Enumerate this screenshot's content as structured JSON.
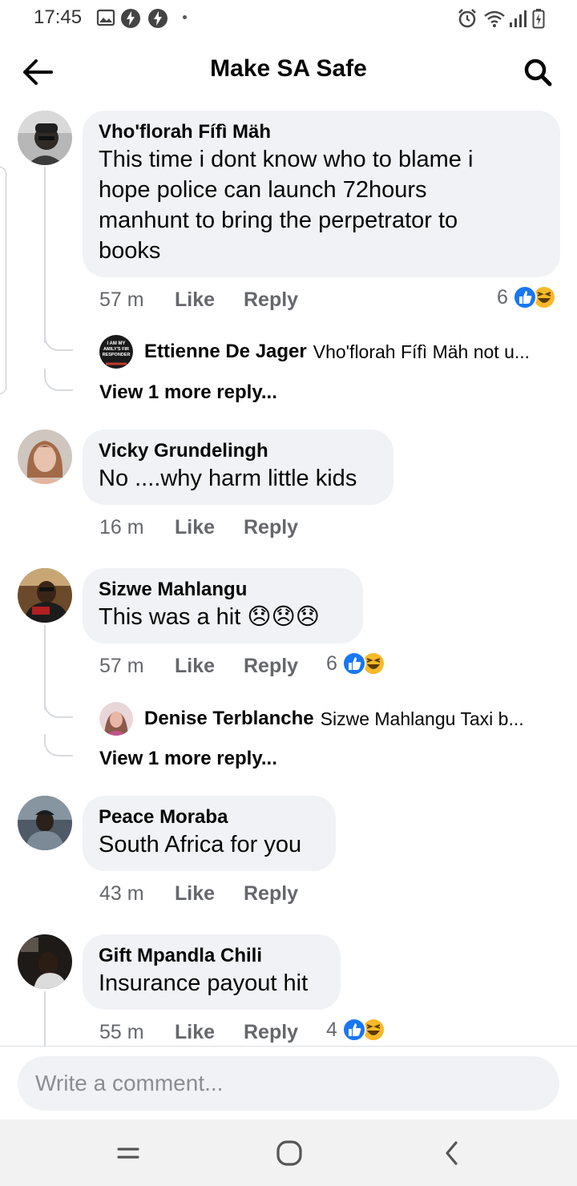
{
  "status_bar": {
    "time": "17:45",
    "icons": [
      "gallery-icon",
      "flash-icon",
      "flash-icon",
      "alarm-icon",
      "wifi-icon",
      "signal-icon",
      "battery-icon"
    ]
  },
  "header": {
    "title": "Make SA Safe",
    "back_icon": "arrow-left-icon",
    "search_icon": "search-icon"
  },
  "colors": {
    "bubble": "#f0f2f5",
    "secondary_text": "#65676b",
    "like_blue": "#1877f2",
    "haha_yellow": "#f7b928"
  },
  "comments": [
    {
      "author": "Vho'florah Fífì Mäh",
      "text_lines": [
        "This time i dont know who to blame i",
        "hope police can launch 72hours",
        "manhunt to bring the perpetrator to",
        "books"
      ],
      "time": "57 m",
      "like_label": "Like",
      "reply_label": "Reply",
      "reaction_count": "6",
      "reactions": [
        "like",
        "haha"
      ],
      "reply_preview": {
        "author": "Ettienne De Jager",
        "snippet": "Vho'florah Fífì Mäh not u...",
        "avatar_text": [
          "I AM MY",
          "AMILY'S FIR",
          "RESPONDER"
        ]
      },
      "view_more": "View 1 more reply..."
    },
    {
      "author": "Vicky Grundelingh",
      "text_lines": [
        "No ....why harm little kids"
      ],
      "time": "16 m",
      "like_label": "Like",
      "reply_label": "Reply"
    },
    {
      "author": "Sizwe Mahlangu",
      "text_lines": [
        "This was a hit 😞😞😞"
      ],
      "time": "57 m",
      "like_label": "Like",
      "reply_label": "Reply",
      "reaction_count": "6",
      "reactions": [
        "like",
        "haha"
      ],
      "reply_preview": {
        "author": "Denise Terblanche",
        "snippet": "Sizwe Mahlangu Taxi b..."
      },
      "view_more": "View 1 more reply..."
    },
    {
      "author": "Peace Moraba",
      "text_lines": [
        "South Africa for you"
      ],
      "time": "43 m",
      "like_label": "Like",
      "reply_label": "Reply"
    },
    {
      "author": "Gift Mpandla Chili",
      "text_lines": [
        "Insurance payout hit"
      ],
      "time": "55 m",
      "like_label": "Like",
      "reply_label": "Reply",
      "reaction_count": "4",
      "reactions": [
        "like",
        "haha"
      ]
    }
  ],
  "composer": {
    "placeholder": "Write a comment..."
  },
  "nav_bar": {
    "buttons": [
      "recent-apps-icon",
      "home-icon",
      "back-icon"
    ]
  }
}
